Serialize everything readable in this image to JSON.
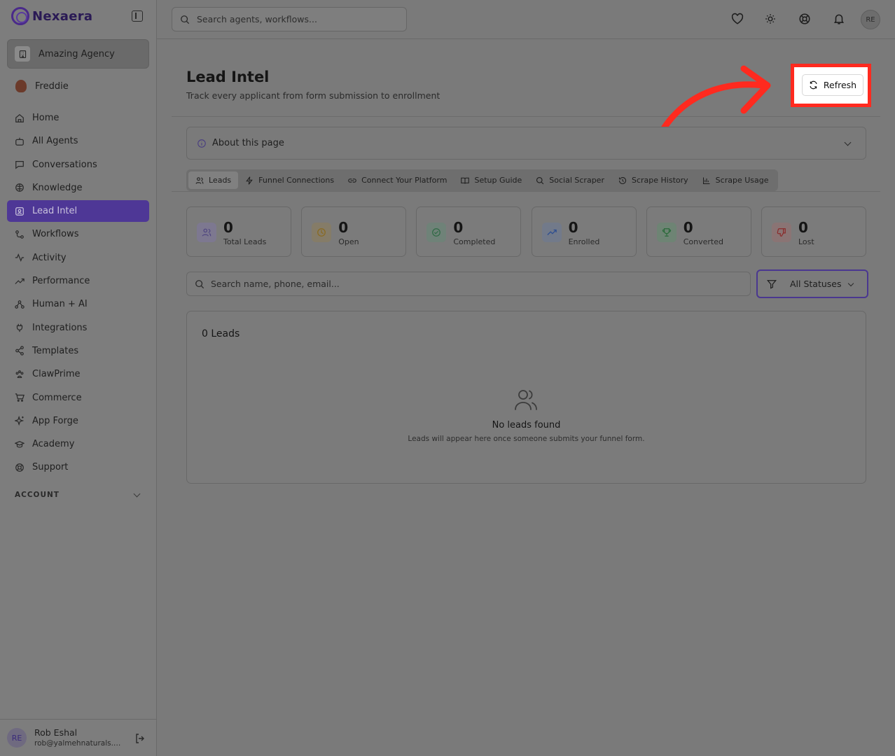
{
  "app": {
    "logo_text": "Nexaera",
    "agency_name": "Amazing Agency",
    "current_user": "Freddie"
  },
  "sidebar": {
    "items": [
      {
        "label": "Home",
        "icon": "home-icon"
      },
      {
        "label": "All Agents",
        "icon": "bot-icon"
      },
      {
        "label": "Conversations",
        "icon": "message-square-icon"
      },
      {
        "label": "Knowledge",
        "icon": "brain-icon"
      },
      {
        "label": "Lead Intel",
        "icon": "contact-icon",
        "active": true
      },
      {
        "label": "Workflows",
        "icon": "workflow-icon"
      },
      {
        "label": "Activity",
        "icon": "activity-icon"
      },
      {
        "label": "Performance",
        "icon": "trending-up-icon"
      },
      {
        "label": "Human + AI",
        "icon": "users-network-icon"
      },
      {
        "label": "Integrations",
        "icon": "plug-icon"
      },
      {
        "label": "Templates",
        "icon": "share-icon"
      },
      {
        "label": "ClawPrime",
        "icon": "paw-icon"
      },
      {
        "label": "Commerce",
        "icon": "cart-icon"
      },
      {
        "label": "App Forge",
        "icon": "sparkles-icon"
      },
      {
        "label": "Academy",
        "icon": "graduation-cap-icon"
      },
      {
        "label": "Support",
        "icon": "life-buoy-icon"
      }
    ],
    "account_section": "ACCOUNT",
    "footer": {
      "initials": "RE",
      "name": "Rob Eshal",
      "email": "rob@yalmehnaturals.c..."
    }
  },
  "topbar": {
    "search_placeholder": "Search agents, workflows...",
    "avatar_initials": "RE",
    "icons": [
      "heart-icon",
      "sun-icon",
      "life-buoy-icon",
      "bell-icon"
    ]
  },
  "page": {
    "title": "Lead Intel",
    "subtitle": "Track every applicant from form submission to enrollment",
    "refresh_label": "Refresh",
    "about_label": "About this page"
  },
  "tabs": [
    {
      "label": "Leads",
      "icon": "users-icon",
      "active": true
    },
    {
      "label": "Funnel Connections",
      "icon": "zap-icon"
    },
    {
      "label": "Connect Your Platform",
      "icon": "link-icon"
    },
    {
      "label": "Setup Guide",
      "icon": "book-open-icon"
    },
    {
      "label": "Social Scraper",
      "icon": "search-icon"
    },
    {
      "label": "Scrape History",
      "icon": "history-icon"
    },
    {
      "label": "Scrape Usage",
      "icon": "bar-chart-icon"
    }
  ],
  "stats": [
    {
      "value": "0",
      "label": "Total Leads",
      "icon": "users-icon",
      "color": "#7a6fa0"
    },
    {
      "value": "0",
      "label": "Open",
      "icon": "clock-icon",
      "color": "#a08a50"
    },
    {
      "value": "0",
      "label": "Completed",
      "icon": "check-circle-icon",
      "color": "#4f8a6a"
    },
    {
      "value": "0",
      "label": "Enrolled",
      "icon": "trending-up-icon",
      "color": "#4a6aa8"
    },
    {
      "value": "0",
      "label": "Converted",
      "icon": "trophy-icon",
      "color": "#3f8a55"
    },
    {
      "value": "0",
      "label": "Lost",
      "icon": "thumbs-down-icon",
      "color": "#b04a4a"
    }
  ],
  "filters": {
    "search_placeholder": "Search name, phone, email...",
    "status_value": "All Statuses"
  },
  "leads": {
    "count_label": "0 Leads",
    "empty_title": "No leads found",
    "empty_subtitle": "Leads will appear here once someone submits your funnel form."
  },
  "colors": {
    "accent": "#4e3796",
    "highlight": "#ff2a1f"
  }
}
